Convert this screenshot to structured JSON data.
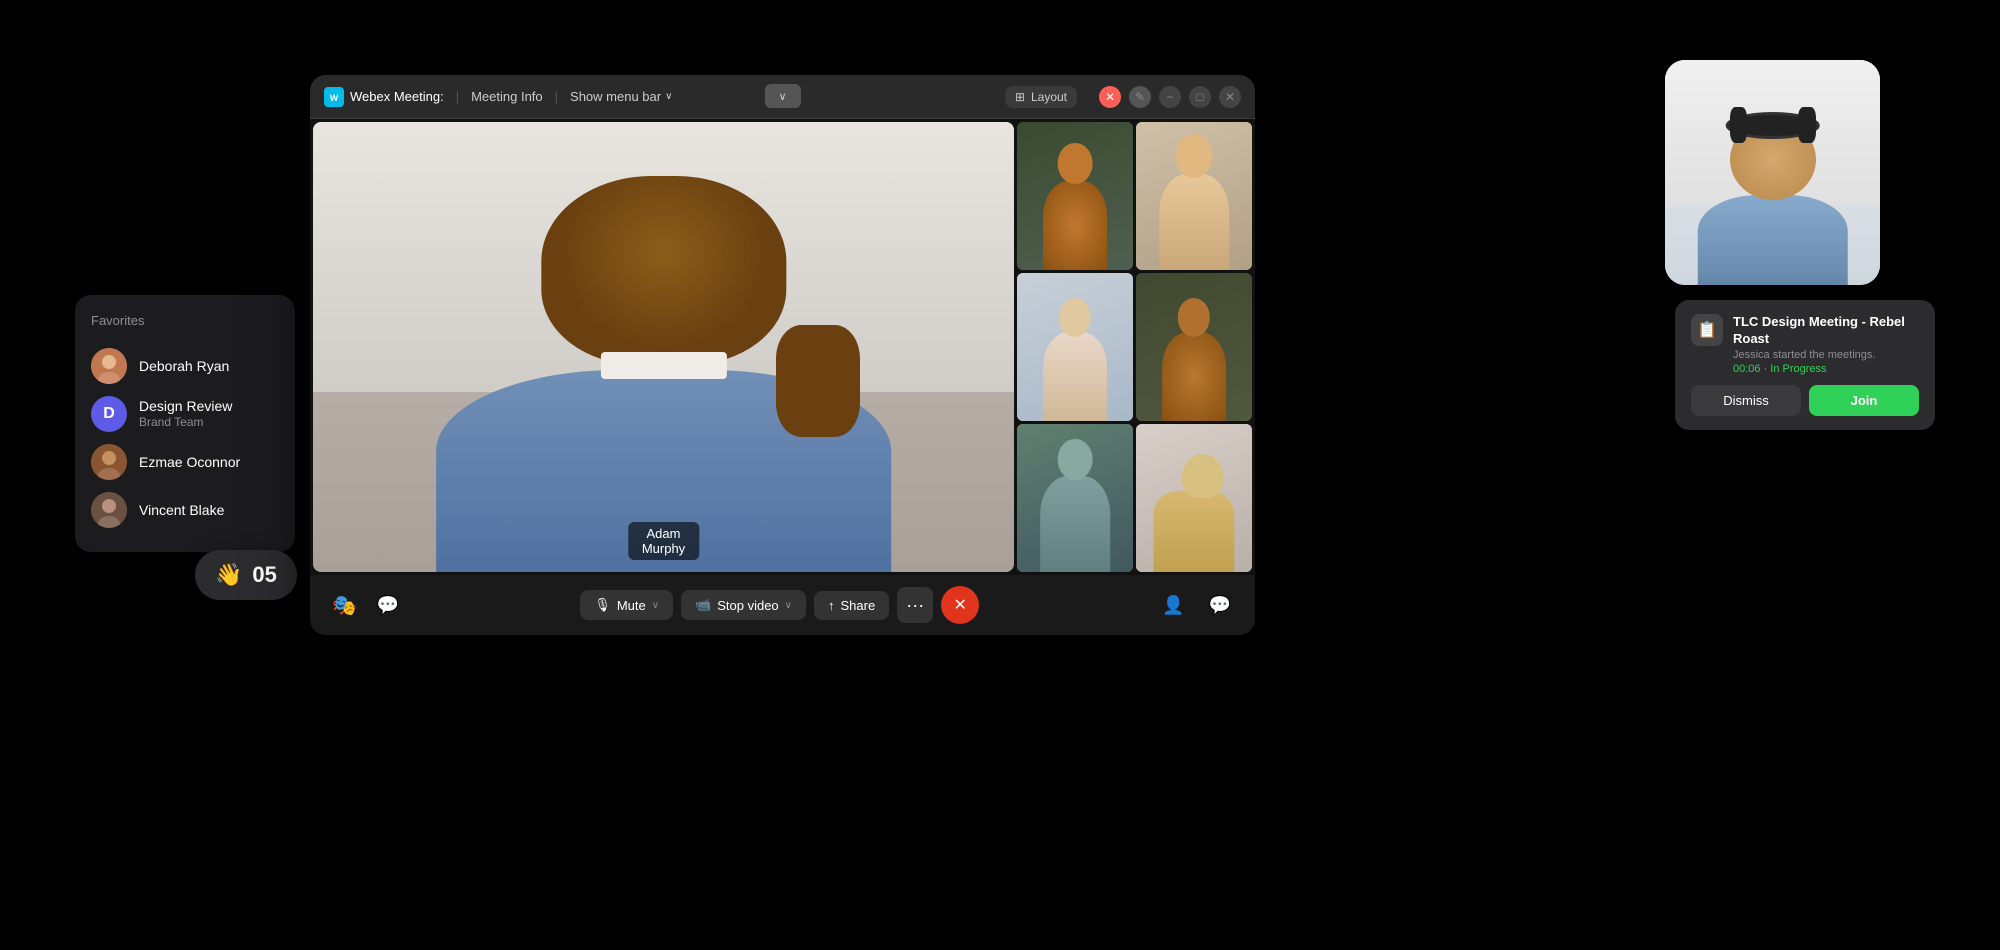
{
  "page": {
    "background": "#000"
  },
  "favorites": {
    "title": "Favorites",
    "items": [
      {
        "id": "deborah",
        "name": "Deborah Ryan",
        "initial": "",
        "emoji": "👤",
        "avatar_color": "brown",
        "sub": ""
      },
      {
        "id": "design",
        "name": "Design Review",
        "initial": "D",
        "sub": "Brand Team",
        "avatar_color": "purple"
      },
      {
        "id": "ezmae",
        "name": "Ezmae Oconnor",
        "initial": "",
        "emoji": "👤",
        "avatar_color": "tan",
        "sub": ""
      },
      {
        "id": "vincent",
        "name": "Vincent Blake",
        "initial": "",
        "emoji": "👤",
        "avatar_color": "brown2",
        "sub": ""
      }
    ]
  },
  "emoji_badge": {
    "emoji": "👋",
    "count": "05"
  },
  "webex_window": {
    "title": "Webex Meeting:",
    "meeting_info": "Meeting Info",
    "show_menu_bar": "Show menu bar",
    "layout_btn": "Layout",
    "dropdown_chevron": "∨"
  },
  "main_video": {
    "speaker_name": "Adam",
    "speaker_surname": "Murphy"
  },
  "controls": {
    "mute": "Mute",
    "stop_video": "Stop video",
    "share": "Share",
    "more": "···",
    "end": "✕"
  },
  "notification": {
    "title": "TLC Design Meeting - Rebel Roast",
    "subtitle": "Jessica started the meetings.",
    "status": "00:06 · In Progress",
    "dismiss_label": "Dismiss",
    "join_label": "Join"
  }
}
